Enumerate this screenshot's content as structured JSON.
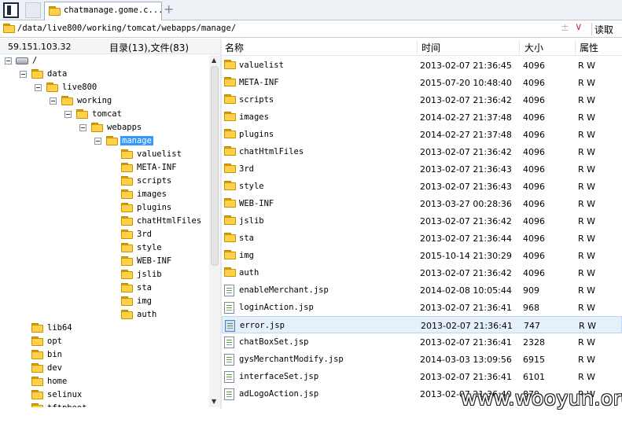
{
  "tabbar": {
    "tab_title": "chatmanage.gome.c...",
    "add_label": "+"
  },
  "addressbar": {
    "path": "/data/live800/working/tomcat/webapps/manage/",
    "dim_symbol": "±",
    "dropdown_symbol": "∨",
    "read_label": "读取"
  },
  "infobar": {
    "ip": "59.151.103.32",
    "counts": "目录(13),文件(83)"
  },
  "tree": {
    "root": "/",
    "nodes": [
      {
        "label": "data"
      },
      {
        "label": "live800"
      },
      {
        "label": "working"
      },
      {
        "label": "tomcat"
      },
      {
        "label": "webapps"
      },
      {
        "label": "manage"
      },
      {
        "label": "valuelist"
      },
      {
        "label": "META-INF"
      },
      {
        "label": "scripts"
      },
      {
        "label": "images"
      },
      {
        "label": "plugins"
      },
      {
        "label": "chatHtmlFiles"
      },
      {
        "label": "3rd"
      },
      {
        "label": "style"
      },
      {
        "label": "WEB-INF"
      },
      {
        "label": "jslib"
      },
      {
        "label": "sta"
      },
      {
        "label": "img"
      },
      {
        "label": "auth"
      },
      {
        "label": "lib64"
      },
      {
        "label": "opt"
      },
      {
        "label": "bin"
      },
      {
        "label": "dev"
      },
      {
        "label": "home"
      },
      {
        "label": "selinux"
      },
      {
        "label": "tftpboot"
      }
    ]
  },
  "list": {
    "headers": {
      "name": "名称",
      "time": "时间",
      "size": "大小",
      "attr": "属性"
    },
    "rows": [
      {
        "name": "valuelist",
        "time": "2013-02-07 21:36:45",
        "size": "4096",
        "attr": "R W"
      },
      {
        "name": "META-INF",
        "time": "2015-07-20 10:48:40",
        "size": "4096",
        "attr": "R W"
      },
      {
        "name": "scripts",
        "time": "2013-02-07 21:36:42",
        "size": "4096",
        "attr": "R W"
      },
      {
        "name": "images",
        "time": "2014-02-27 21:37:48",
        "size": "4096",
        "attr": "R W"
      },
      {
        "name": "plugins",
        "time": "2014-02-27 21:37:48",
        "size": "4096",
        "attr": "R W"
      },
      {
        "name": "chatHtmlFiles",
        "time": "2013-02-07 21:36:42",
        "size": "4096",
        "attr": "R W"
      },
      {
        "name": "3rd",
        "time": "2013-02-07 21:36:43",
        "size": "4096",
        "attr": "R W"
      },
      {
        "name": "style",
        "time": "2013-02-07 21:36:43",
        "size": "4096",
        "attr": "R W"
      },
      {
        "name": "WEB-INF",
        "time": "2013-03-27 00:28:36",
        "size": "4096",
        "attr": "R W"
      },
      {
        "name": "jslib",
        "time": "2013-02-07 21:36:42",
        "size": "4096",
        "attr": "R W"
      },
      {
        "name": "sta",
        "time": "2013-02-07 21:36:44",
        "size": "4096",
        "attr": "R W"
      },
      {
        "name": "img",
        "time": "2015-10-14 21:30:29",
        "size": "4096",
        "attr": "R W"
      },
      {
        "name": "auth",
        "time": "2013-02-07 21:36:42",
        "size": "4096",
        "attr": "R W"
      },
      {
        "name": "enableMerchant.jsp",
        "time": "2014-02-08 10:05:44",
        "size": "909",
        "attr": "R W"
      },
      {
        "name": "loginAction.jsp",
        "time": "2013-02-07 21:36:41",
        "size": "968",
        "attr": "R W"
      },
      {
        "name": "error.jsp",
        "time": "2013-02-07 21:36:41",
        "size": "747",
        "attr": "R W"
      },
      {
        "name": "chatBoxSet.jsp",
        "time": "2013-02-07 21:36:41",
        "size": "2328",
        "attr": "R W"
      },
      {
        "name": "gysMerchantModify.jsp",
        "time": "2014-03-03 13:09:56",
        "size": "6915",
        "attr": "R W"
      },
      {
        "name": "interfaceSet.jsp",
        "time": "2013-02-07 21:36:41",
        "size": "6101",
        "attr": "R W"
      },
      {
        "name": "adLogoAction.jsp",
        "time": "2013-02-07 21:36:40",
        "size": "879",
        "attr": "R W"
      }
    ]
  },
  "watermark": "www.wooyun.org"
}
